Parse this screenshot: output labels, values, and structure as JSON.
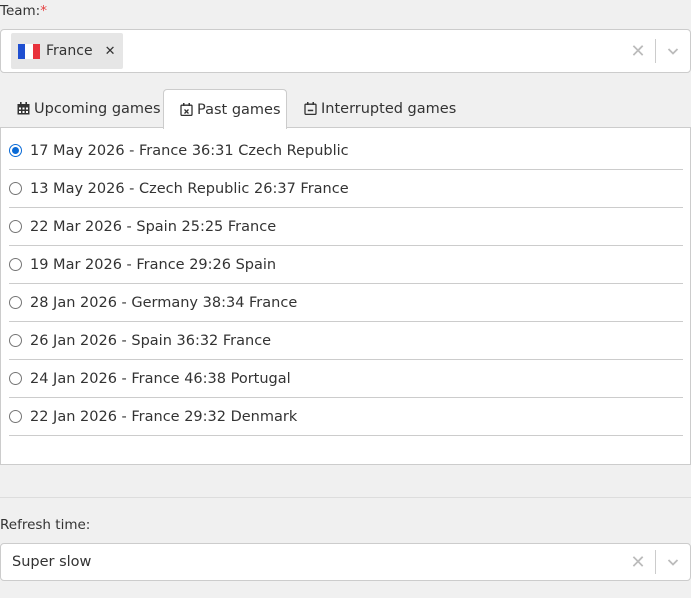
{
  "team": {
    "label": "Team:",
    "required_mark": "*",
    "selected": "France"
  },
  "tabs": [
    {
      "label": "Upcoming games",
      "icon": "calendar-icon",
      "active": false
    },
    {
      "label": "Past games",
      "icon": "calendar-x-icon",
      "active": true
    },
    {
      "label": "Interrupted games",
      "icon": "calendar-minus-icon",
      "active": false
    }
  ],
  "games": [
    {
      "label": "17 May 2026 - France 36:31 Czech Republic",
      "selected": true
    },
    {
      "label": "13 May 2026 - Czech Republic 26:37 France",
      "selected": false
    },
    {
      "label": "22 Mar 2026 - Spain 25:25 France",
      "selected": false
    },
    {
      "label": "19 Mar 2026 - France 29:26 Spain",
      "selected": false
    },
    {
      "label": "28 Jan 2026 - Germany 38:34 France",
      "selected": false
    },
    {
      "label": "26 Jan 2026 - Spain 36:32 France",
      "selected": false
    },
    {
      "label": "24 Jan 2026 - France 46:38 Portugal",
      "selected": false
    },
    {
      "label": "22 Jan 2026 - France 29:32 Denmark",
      "selected": false
    }
  ],
  "refresh": {
    "label": "Refresh time:",
    "value": "Super slow"
  },
  "colors": {
    "accent": "#0a6ad6",
    "required": "#e53e3e",
    "background": "#f0f0f0"
  }
}
